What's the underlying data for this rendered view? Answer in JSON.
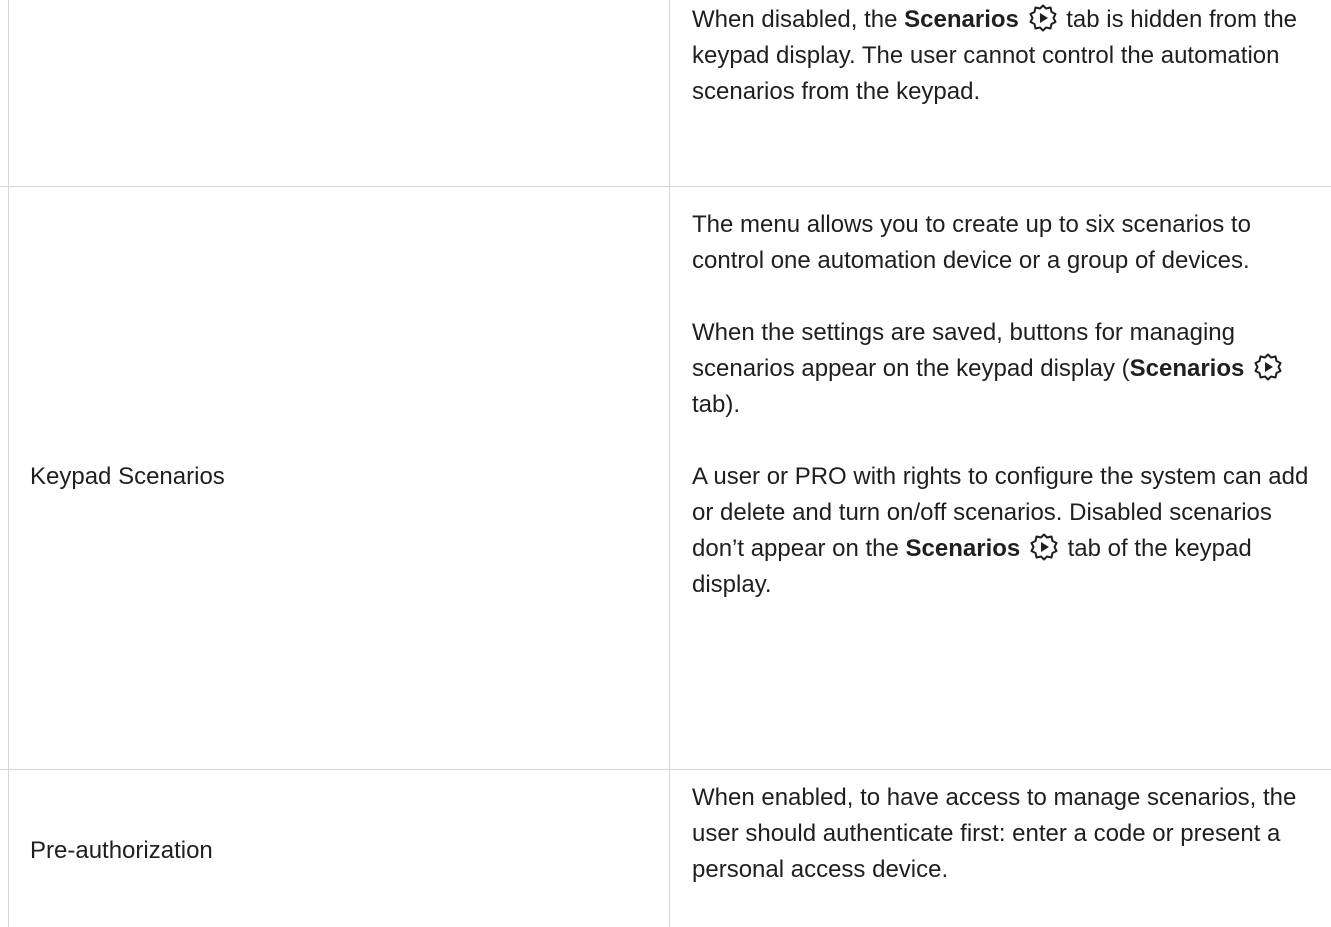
{
  "rows": [
    {
      "name": "",
      "paragraphs": [
        {
          "before": "When disabled, the ",
          "bold": "Scenarios",
          "after": " tab is hidden from the keypad display. The user cannot control the automation scenarios from the keypad."
        }
      ]
    },
    {
      "name": "Keypad Scenarios",
      "paragraphs": [
        {
          "text": "The menu allows you to create up to six scenarios to control one automation device or a group of devices."
        },
        {
          "before": "When the settings are saved, buttons for managing scenarios appear on the keypad display (",
          "bold": "Scenarios",
          "after": " tab)."
        },
        {
          "before": "A user or PRO with rights to configure the system can add or delete and turn on/off scenarios. Disabled scenarios don’t appear on the ",
          "bold": "Scenarios",
          "after": " tab of the keypad display."
        }
      ]
    },
    {
      "name": "Pre-authorization",
      "paragraphs": [
        {
          "text": "When enabled, to have access to manage scenarios, the user should authenticate first: enter a code or present a personal access device."
        }
      ]
    }
  ],
  "icons": {
    "scenarios": "scenarios-gear-play-icon"
  }
}
